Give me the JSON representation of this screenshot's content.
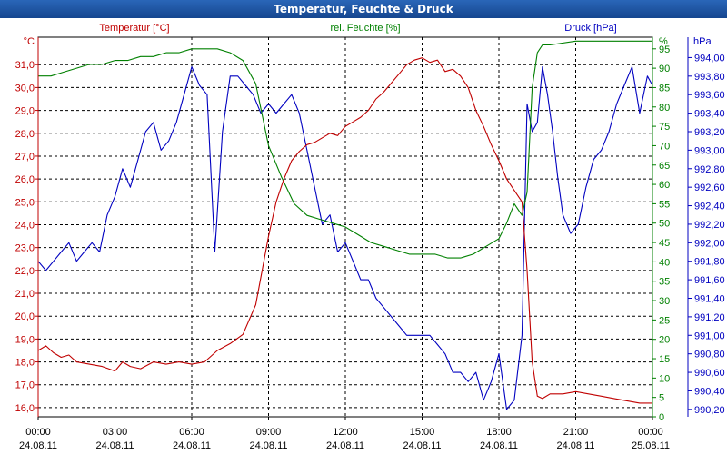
{
  "window": {
    "title": "Temperatur, Feuchte & Druck"
  },
  "chart_data": {
    "type": "line",
    "title": "Temperatur, Feuchte & Druck",
    "grid": true,
    "x": {
      "ticks": [
        {
          "time": "00:00",
          "date": "24.08.11"
        },
        {
          "time": "03:00",
          "date": "24.08.11"
        },
        {
          "time": "06:00",
          "date": "24.08.11"
        },
        {
          "time": "09:00",
          "date": "24.08.11"
        },
        {
          "time": "12:00",
          "date": "24.08.11"
        },
        {
          "time": "15:00",
          "date": "24.08.11"
        },
        {
          "time": "18:00",
          "date": "24.08.11"
        },
        {
          "time": "21:00",
          "date": "24.08.11"
        },
        {
          "time": "00:00",
          "date": "25.08.11"
        }
      ],
      "range_hours": [
        0,
        24
      ]
    },
    "axes": {
      "temperature": {
        "label": "Temperatur [°C]",
        "unit": "°C",
        "range": [
          15.6,
          32.2
        ],
        "ticks": [
          16.0,
          17.0,
          18.0,
          19.0,
          20.0,
          21.0,
          22.0,
          23.0,
          24.0,
          25.0,
          26.0,
          27.0,
          28.0,
          29.0,
          30.0,
          31.0
        ],
        "decimals": 1,
        "color": "#c00000"
      },
      "humidity": {
        "label": "rel. Feuchte [%]",
        "unit": "%",
        "range": [
          0,
          98
        ],
        "ticks": [
          0,
          5,
          10,
          15,
          20,
          25,
          30,
          35,
          40,
          45,
          50,
          55,
          60,
          65,
          70,
          75,
          80,
          85,
          90,
          95
        ],
        "decimals": 0,
        "color": "#008000"
      },
      "pressure": {
        "label": "Druck [hPa]",
        "unit": "hPa",
        "range": [
          990.12,
          994.22
        ],
        "ticks": [
          990.2,
          990.4,
          990.6,
          990.8,
          991.0,
          991.2,
          991.4,
          991.6,
          991.8,
          992.0,
          992.2,
          992.4,
          992.6,
          992.8,
          993.0,
          993.2,
          993.4,
          993.6,
          993.8,
          994.0
        ],
        "decimals": 2,
        "color": "#0000c0"
      }
    },
    "series": [
      {
        "name": "Temperatur [°C]",
        "axis": "temperature",
        "color": "#c00000",
        "x": [
          0,
          0.3,
          0.6,
          0.9,
          1.2,
          1.5,
          2,
          2.5,
          3,
          3.3,
          3.6,
          4,
          4.5,
          5,
          5.5,
          6,
          6.5,
          7,
          7.5,
          8,
          8.5,
          9,
          9.3,
          9.6,
          9.9,
          10.2,
          10.5,
          10.8,
          11.1,
          11.4,
          11.7,
          12,
          12.3,
          12.6,
          12.9,
          13.2,
          13.5,
          13.8,
          14.1,
          14.4,
          14.7,
          15,
          15.3,
          15.6,
          15.9,
          16.2,
          16.5,
          16.8,
          17.1,
          17.4,
          17.7,
          18,
          18.3,
          18.6,
          18.9,
          19.1,
          19.3,
          19.5,
          19.7,
          20,
          20.5,
          21,
          21.5,
          22,
          22.5,
          23,
          23.5,
          24
        ],
        "values": [
          18.5,
          18.7,
          18.4,
          18.2,
          18.3,
          18.0,
          17.9,
          17.8,
          17.6,
          18.0,
          17.8,
          17.7,
          18.0,
          17.9,
          18.0,
          17.9,
          18.0,
          18.5,
          18.8,
          19.2,
          20.5,
          23.5,
          25.0,
          26.0,
          26.8,
          27.2,
          27.5,
          27.6,
          27.8,
          28.0,
          27.9,
          28.3,
          28.5,
          28.7,
          29.0,
          29.5,
          29.8,
          30.2,
          30.6,
          31.0,
          31.2,
          31.3,
          31.1,
          31.2,
          30.7,
          30.8,
          30.5,
          30.0,
          29.0,
          28.3,
          27.5,
          26.8,
          26.0,
          25.5,
          25.0,
          22.0,
          18.0,
          16.5,
          16.4,
          16.6,
          16.6,
          16.7,
          16.6,
          16.5,
          16.4,
          16.3,
          16.2,
          16.2
        ]
      },
      {
        "name": "rel. Feuchte [%]",
        "axis": "humidity",
        "color": "#008000",
        "x": [
          0,
          0.5,
          1,
          1.5,
          2,
          2.5,
          3,
          3.5,
          4,
          4.5,
          5,
          5.5,
          6,
          6.5,
          7,
          7.5,
          8,
          8.5,
          9,
          9.5,
          10,
          10.5,
          11,
          11.5,
          12,
          12.5,
          13,
          13.5,
          14,
          14.5,
          15,
          15.5,
          16,
          16.5,
          17,
          17.5,
          18,
          18.3,
          18.6,
          18.9,
          19.1,
          19.3,
          19.5,
          19.7,
          20,
          21,
          22,
          23,
          24
        ],
        "values": [
          88,
          88,
          89,
          90,
          91,
          91,
          92,
          92,
          93,
          93,
          94,
          94,
          95,
          95,
          95,
          94,
          92,
          86,
          70,
          62,
          55,
          52,
          51,
          50,
          49,
          47,
          45,
          44,
          43,
          42,
          42,
          42,
          41,
          41,
          42,
          44,
          46,
          50,
          55,
          52,
          58,
          85,
          94,
          96,
          96,
          97,
          97,
          97,
          97
        ]
      },
      {
        "name": "Druck [hPa]",
        "axis": "pressure",
        "color": "#0000c0",
        "x": [
          0,
          0.3,
          0.6,
          0.9,
          1.2,
          1.5,
          1.8,
          2.1,
          2.4,
          2.7,
          3,
          3.3,
          3.6,
          3.9,
          4.2,
          4.5,
          4.8,
          5.1,
          5.4,
          5.7,
          6,
          6.3,
          6.6,
          6.9,
          7.2,
          7.5,
          7.8,
          8.1,
          8.4,
          8.7,
          9,
          9.3,
          9.6,
          9.9,
          10.2,
          10.5,
          10.8,
          11.1,
          11.4,
          11.7,
          12,
          12.3,
          12.6,
          12.9,
          13.2,
          13.5,
          13.8,
          14.1,
          14.4,
          14.7,
          15,
          15.3,
          15.6,
          15.9,
          16.2,
          16.5,
          16.8,
          17.1,
          17.4,
          17.7,
          18,
          18.3,
          18.6,
          18.9,
          19.1,
          19.3,
          19.5,
          19.7,
          19.9,
          20.1,
          20.3,
          20.5,
          20.8,
          21.1,
          21.4,
          21.7,
          22,
          22.3,
          22.6,
          22.9,
          23.2,
          23.5,
          23.8,
          24
        ],
        "values": [
          991.8,
          991.7,
          991.8,
          991.9,
          992.0,
          991.8,
          991.9,
          992.0,
          991.9,
          992.3,
          992.5,
          992.8,
          992.6,
          992.9,
          993.2,
          993.3,
          993.0,
          993.1,
          993.3,
          993.6,
          993.9,
          993.7,
          993.6,
          991.9,
          993.2,
          993.8,
          993.8,
          993.7,
          993.6,
          993.4,
          993.5,
          993.4,
          993.5,
          993.6,
          993.4,
          993.0,
          992.6,
          992.2,
          992.3,
          991.9,
          992.0,
          991.8,
          991.6,
          991.6,
          991.4,
          991.3,
          991.2,
          991.1,
          991.0,
          991.0,
          991.0,
          991.0,
          990.9,
          990.8,
          990.6,
          990.6,
          990.5,
          990.6,
          990.3,
          990.5,
          990.8,
          990.2,
          990.3,
          991.0,
          993.5,
          993.2,
          993.3,
          993.9,
          993.6,
          993.2,
          992.7,
          992.3,
          992.1,
          992.2,
          992.6,
          992.9,
          993.0,
          993.2,
          993.5,
          993.7,
          993.9,
          993.4,
          993.8,
          993.7
        ]
      }
    ]
  }
}
